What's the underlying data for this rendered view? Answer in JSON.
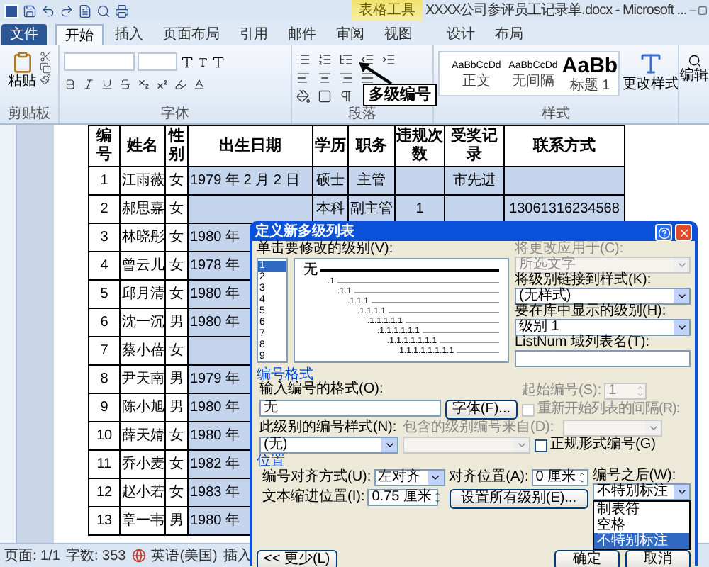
{
  "window": {
    "title": "XXXX公司参评员工记录单.docx - Microsoft ...",
    "contextual_tab": "表格工具"
  },
  "tabs": [
    {
      "label": "文件",
      "selected": false,
      "kind": "file"
    },
    {
      "label": "开始",
      "selected": true,
      "kind": "normal"
    },
    {
      "label": "插入",
      "selected": false,
      "kind": "normal"
    },
    {
      "label": "页面布局",
      "selected": false,
      "kind": "normal"
    },
    {
      "label": "引用",
      "selected": false,
      "kind": "normal"
    },
    {
      "label": "邮件",
      "selected": false,
      "kind": "normal"
    },
    {
      "label": "审阅",
      "selected": false,
      "kind": "normal"
    },
    {
      "label": "视图",
      "selected": false,
      "kind": "normal"
    },
    {
      "label": "设计",
      "selected": false,
      "kind": "contextual"
    },
    {
      "label": "布局",
      "selected": false,
      "kind": "contextual"
    }
  ],
  "ribbon": {
    "paste": "粘贴",
    "clipboard": "剪贴板",
    "font": "字体",
    "paragraph": "段落",
    "styles": [
      {
        "preview": "AaBbCcDd",
        "name": "正文",
        "kind": "small"
      },
      {
        "preview": "AaBbCcDd",
        "name": "无间隔",
        "kind": "small"
      },
      {
        "preview": "AaBb",
        "name": "标题 1",
        "kind": "large"
      }
    ],
    "change_styles": "更改样式",
    "styles_label": "样式",
    "editing": "编辑"
  },
  "tooltip": "多级编号",
  "table": {
    "columns": [
      "编号",
      "姓名",
      "性别",
      "出生日期",
      "学历",
      "职务",
      "违规次数",
      "受奖记录",
      "联系方式"
    ],
    "rows": [
      {
        "cells": [
          "1",
          "江雨薇",
          "女",
          "1979 年 2 月 2 日",
          "硕士",
          "主管",
          "",
          "市先进",
          ""
        ]
      },
      {
        "cells": [
          "2",
          "郝思嘉",
          "女",
          "",
          "本科",
          "副主管",
          "1",
          "",
          "13061316234568"
        ]
      },
      {
        "cells": [
          "3",
          "林晓彤",
          "女",
          "1980 年"
        ]
      },
      {
        "cells": [
          "4",
          "曾云儿",
          "女",
          "1978 年"
        ]
      },
      {
        "cells": [
          "5",
          "邱月清",
          "女",
          "1980 年"
        ]
      },
      {
        "cells": [
          "6",
          "沈一沉",
          "男",
          "1980 年"
        ]
      },
      {
        "cells": [
          "7",
          "蔡小蓓",
          "女",
          ""
        ]
      },
      {
        "cells": [
          "8",
          "尹天南",
          "男",
          "1979 年"
        ]
      },
      {
        "cells": [
          "9",
          "陈小旭",
          "男",
          "1980 年"
        ]
      },
      {
        "cells": [
          "10",
          "薛天婧",
          "女",
          "1980 年"
        ]
      },
      {
        "cells": [
          "11",
          "乔小麦",
          "女",
          "1982 年"
        ]
      },
      {
        "cells": [
          "12",
          "赵小若",
          "女",
          "1983 年"
        ]
      },
      {
        "cells": [
          "13",
          "章一韦",
          "男",
          "1980 年"
        ]
      }
    ]
  },
  "dialog": {
    "title": "定义新多级列表",
    "level_label": "单击要修改的级别(V):",
    "levels": [
      {
        "label": "1",
        "selected": true
      },
      {
        "label": "2",
        "selected": false
      },
      {
        "label": "3",
        "selected": false
      },
      {
        "label": "4",
        "selected": false
      },
      {
        "label": "5",
        "selected": false
      },
      {
        "label": "6",
        "selected": false
      },
      {
        "label": "7",
        "selected": false
      },
      {
        "label": "8",
        "selected": false
      },
      {
        "label": "9",
        "selected": false
      }
    ],
    "preview": [
      "无",
      ".1",
      ".1.1",
      ".1.1.1",
      ".1.1.1.1",
      ".1.1.1.1.1",
      ".1.1.1.1.1.1",
      ".1.1.1.1.1.1.1",
      ".1.1.1.1.1.1.1.1"
    ],
    "apply_to": {
      "label": "将更改应用于(C):",
      "value": "所选文字",
      "disabled": true
    },
    "link_style": {
      "label": "将级别链接到样式(K):",
      "value": "(无样式)",
      "disabled": false
    },
    "gallery_level": {
      "label": "要在库中显示的级别(H):",
      "value": "级别 1",
      "disabled": false
    },
    "listnum": {
      "label": "ListNum 域列表名(T):"
    },
    "format_section": "编号格式",
    "format_input": {
      "label": "输入编号的格式(O):",
      "value": "无"
    },
    "font_button": "字体(F)...",
    "start_at": {
      "label": "起始编号(S):",
      "value": "1",
      "disabled": true
    },
    "restart": {
      "label": "重新开始列表的间隔(R):",
      "checked": false,
      "disabled": true
    },
    "number_style": {
      "label": "此级别的编号样式(N):",
      "value": "(无)",
      "disabled": false
    },
    "include_level": {
      "label": "包含的级别编号来自(D):",
      "disabled": true
    },
    "legal": {
      "label": "正规形式编号(G)",
      "checked": false,
      "disabled": false
    },
    "position_section": "位置",
    "alignment": {
      "label": "编号对齐方式(U):",
      "value": "左对齐"
    },
    "aligned_at": {
      "label": "对齐位置(A):",
      "value": "0 厘米"
    },
    "follow": {
      "label": "编号之后(W):",
      "value": "不特别标注",
      "options": [
        {
          "label": "制表符",
          "selected": false
        },
        {
          "label": "空格",
          "selected": false
        },
        {
          "label": "不特别标注",
          "selected": true
        }
      ]
    },
    "indent": {
      "label": "文本缩进位置(I):",
      "value": "0.75 厘米"
    },
    "set_all": "设置所有级别(E)...",
    "less": "<< 更少(L)",
    "ok": "确定",
    "cancel": "取消"
  },
  "status_bar": [
    {
      "text": "页面: 1/1",
      "kind": "text"
    },
    {
      "text": "字数: 353",
      "kind": "text"
    },
    {
      "kind": "icon"
    },
    {
      "text": "英语(美国)",
      "kind": "text"
    },
    {
      "text": "插入",
      "kind": "text"
    }
  ]
}
